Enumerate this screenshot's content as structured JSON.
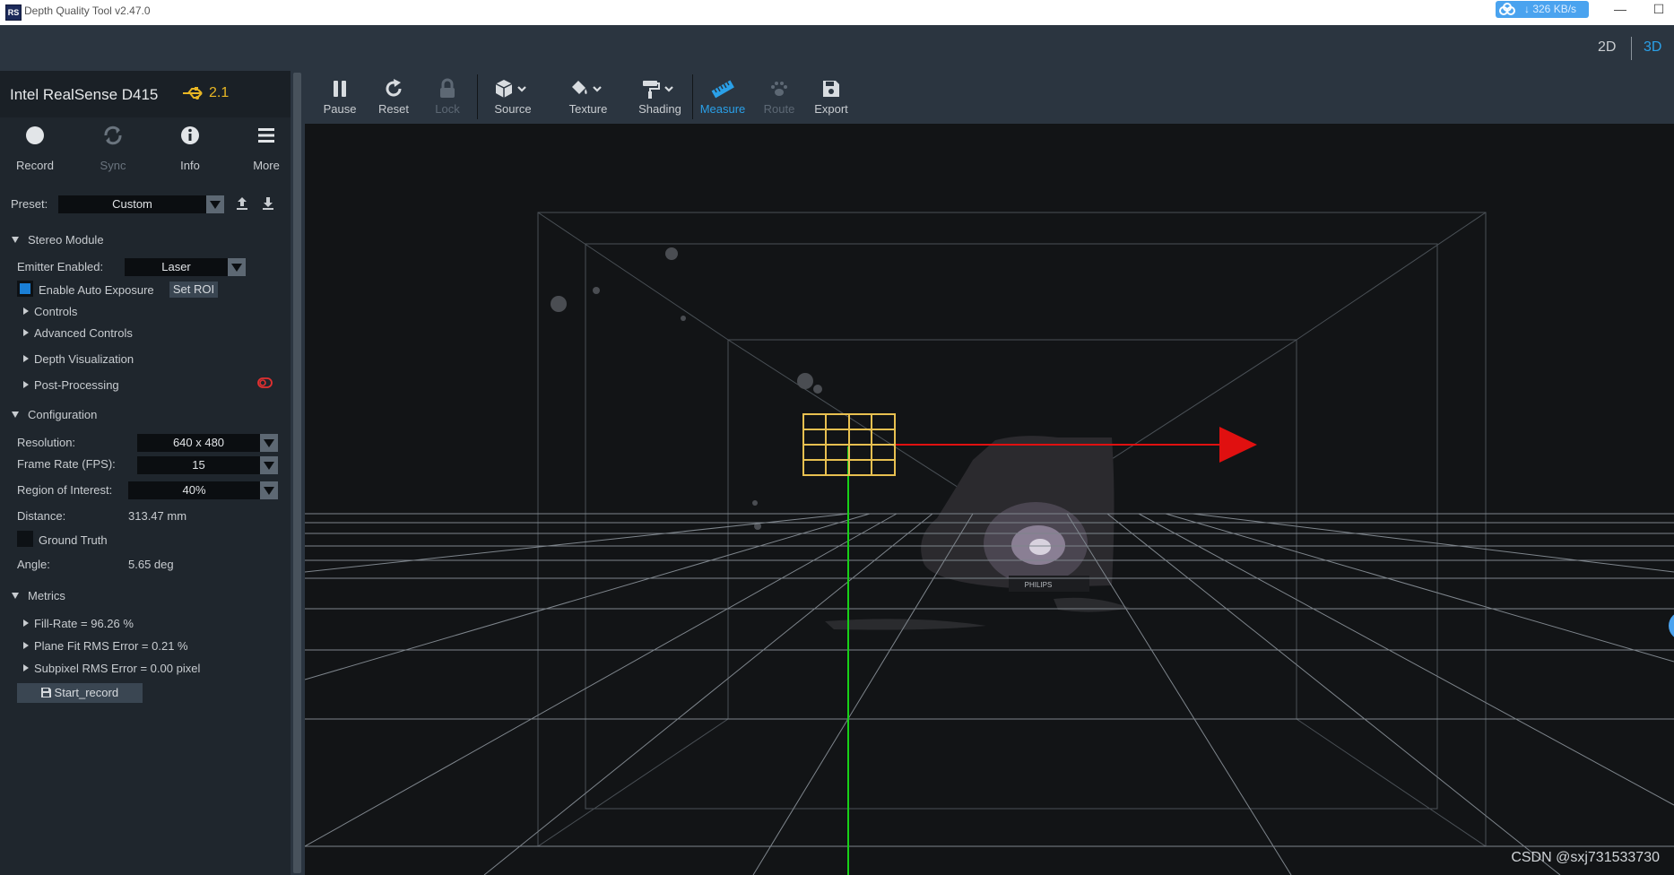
{
  "window": {
    "title": "Depth Quality Tool v2.47.0",
    "app_icon_text": "RS",
    "net_speed": "↓ 326 KB/s",
    "minimize": "—",
    "maximize": "☐"
  },
  "view_modes": {
    "mode_2d": "2D",
    "mode_3d": "3D",
    "active": "3D",
    "active_color": "#2aa0e8"
  },
  "device": {
    "name": "Intel RealSense D415",
    "usb_version": "2.1",
    "usb_color": "#e8b624"
  },
  "device_tools": [
    {
      "label": "Record",
      "icon": "record-icon",
      "enabled": true
    },
    {
      "label": "Sync",
      "icon": "sync-icon",
      "enabled": false
    },
    {
      "label": "Info",
      "icon": "info-icon",
      "enabled": true
    },
    {
      "label": "More",
      "icon": "menu-icon",
      "enabled": true
    }
  ],
  "preset": {
    "label": "Preset:",
    "value": "Custom"
  },
  "stereo_module": {
    "title": "Stereo Module",
    "emitter_label": "Emitter Enabled:",
    "emitter_value": "Laser",
    "auto_exposure_label": "Enable Auto Exposure",
    "auto_exposure_checked": true,
    "set_roi": "Set ROI",
    "controls": "Controls",
    "advanced_controls": "Advanced Controls",
    "depth_visualization": "Depth Visualization",
    "post_processing": "Post-Processing"
  },
  "configuration": {
    "title": "Configuration",
    "resolution_label": "Resolution:",
    "resolution_value": "640 x 480",
    "fps_label": "Frame Rate (FPS):",
    "fps_value": "15",
    "roi_label": "Region of Interest:",
    "roi_value": "40%",
    "distance_label": "Distance:",
    "distance_value": "313.47 mm",
    "ground_truth_label": "Ground Truth",
    "ground_truth_checked": false,
    "angle_label": "Angle:",
    "angle_value": "5.65 deg"
  },
  "metrics": {
    "title": "Metrics",
    "items": [
      "Fill-Rate = 96.26 %",
      "Plane Fit RMS Error = 0.21 %",
      "Subpixel RMS Error = 0.00 pixel"
    ],
    "start_record": "Start_record"
  },
  "toolbar": [
    {
      "label": "Pause",
      "icon": "pause-icon",
      "state": "normal"
    },
    {
      "label": "Reset",
      "icon": "reset-icon",
      "state": "normal"
    },
    {
      "label": "Lock",
      "icon": "lock-icon",
      "state": "disabled"
    },
    {
      "label": "Source",
      "icon": "cube-icon",
      "state": "normal"
    },
    {
      "label": "Texture",
      "icon": "paint-bucket-icon",
      "state": "normal"
    },
    {
      "label": "Shading",
      "icon": "paint-roller-icon",
      "state": "normal"
    },
    {
      "label": "Measure",
      "icon": "ruler-icon",
      "state": "active"
    },
    {
      "label": "Route",
      "icon": "paw-icon",
      "state": "disabled"
    },
    {
      "label": "Export",
      "icon": "save-icon",
      "state": "normal"
    }
  ],
  "viewport": {
    "object_label": "PHILIPS",
    "axis_x_color": "#e01010",
    "axis_y_color": "#18d018",
    "roi_color": "#e8c050"
  },
  "watermark": "CSDN @sxj731533730"
}
